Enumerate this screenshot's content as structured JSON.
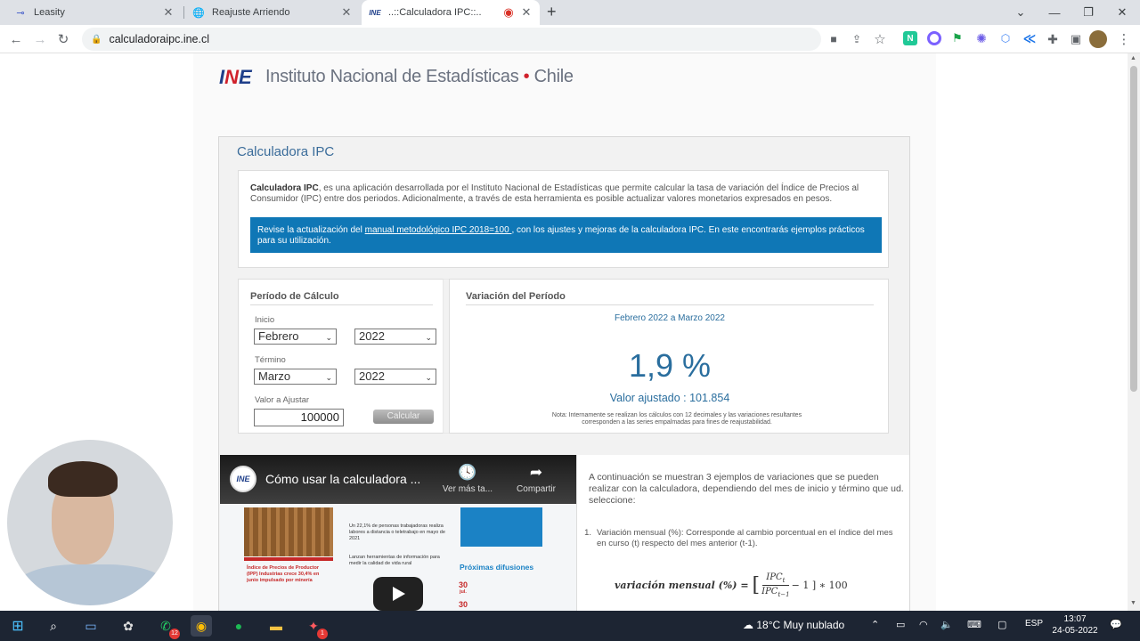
{
  "browser": {
    "tabs": [
      {
        "title": "Leasity",
        "icon": "leasity-icon"
      },
      {
        "title": "Reajuste Arriendo",
        "icon": "globe-icon"
      },
      {
        "title": "..::Calculadora IPC::..",
        "icon": "ine-icon",
        "active": true
      }
    ],
    "url": "calculadoraipc.ine.cl"
  },
  "site": {
    "logo_text": "INE",
    "header": "Instituto Nacional de Estadísticas",
    "header_sep": " • ",
    "header_country": "Chile"
  },
  "calculator": {
    "title": "Calculadora IPC",
    "intro_bold": "Calculadora IPC",
    "intro_rest": ", es una aplicación desarrollada por el Instituto Nacional de Estadísticas que permite calcular la tasa de variación del Índice de Precios al Consumidor (IPC) entre dos periodos. Adicionalmente, a través de esta herramienta es posible actualizar valores monetarios expresados en pesos.",
    "notice_pre": "Revise la actualización del ",
    "notice_link": "manual metodológico IPC 2018=100 ",
    "notice_post": ", con los ajustes y mejoras de la calculadora IPC. En este encontrarás ejemplos prácticos para su utilización.",
    "period": {
      "title": "Período de Cálculo",
      "start_label": "Inicio",
      "start_month": "Febrero",
      "start_year": "2022",
      "end_label": "Término",
      "end_month": "Marzo",
      "end_year": "2022",
      "value_label": "Valor a Ajustar",
      "value": "100000",
      "button": "Calcular"
    },
    "variation": {
      "title": "Variación del Período",
      "range": "Febrero 2022 a Marzo 2022",
      "percent": "1,9 %",
      "adjusted": "Valor ajustado : 101.854",
      "note": "Nota: Internamente se realizan los cálculos con 12 decimales y las variaciones resultantes corresponden a las series empalmadas para fines de reajustabilidad."
    }
  },
  "video": {
    "channel": "INE",
    "title": "Cómo usar la calculadora ...",
    "watch_later": "Ver más ta...",
    "share": "Compartir",
    "proximas": "Próximas difusiones",
    "day1": "30",
    "day1_month": "jul.",
    "day2": "30",
    "text1": "Índice de Precios de Productor (IPP) Industrias crece 30,4% en junio impulsado por minería",
    "text2": "Un 22,1% de personas trabajadoras realiza labores a distancia o teletrabajo en mayo de 2021",
    "text3": "Lanzan herramientas de información para medir la calidad de vida rural"
  },
  "examples": {
    "intro": "A continuación se muestran 3 ejemplos de variaciones que se pueden realizar con la calculadora, dependiendo del mes de inicio y término que ud. seleccione:",
    "item1_num": "1.",
    "item1": "Variación mensual (%): Corresponde al cambio porcentual en el índice del mes en curso (t) respecto del mes anterior (t-1).",
    "formula_label": "variación mensual (%) =",
    "formula_num": "IPC",
    "formula_num_sub": "t",
    "formula_den": "IPC",
    "formula_den_sub": "t−1",
    "formula_tail": "− 1 ] ∗ 100"
  },
  "taskbar": {
    "weather": "18°C  Muy nublado",
    "lang": "ESP",
    "time": "13:07",
    "date": "24-05-2022",
    "whatsapp_badge": "12",
    "app_badge": "1"
  }
}
